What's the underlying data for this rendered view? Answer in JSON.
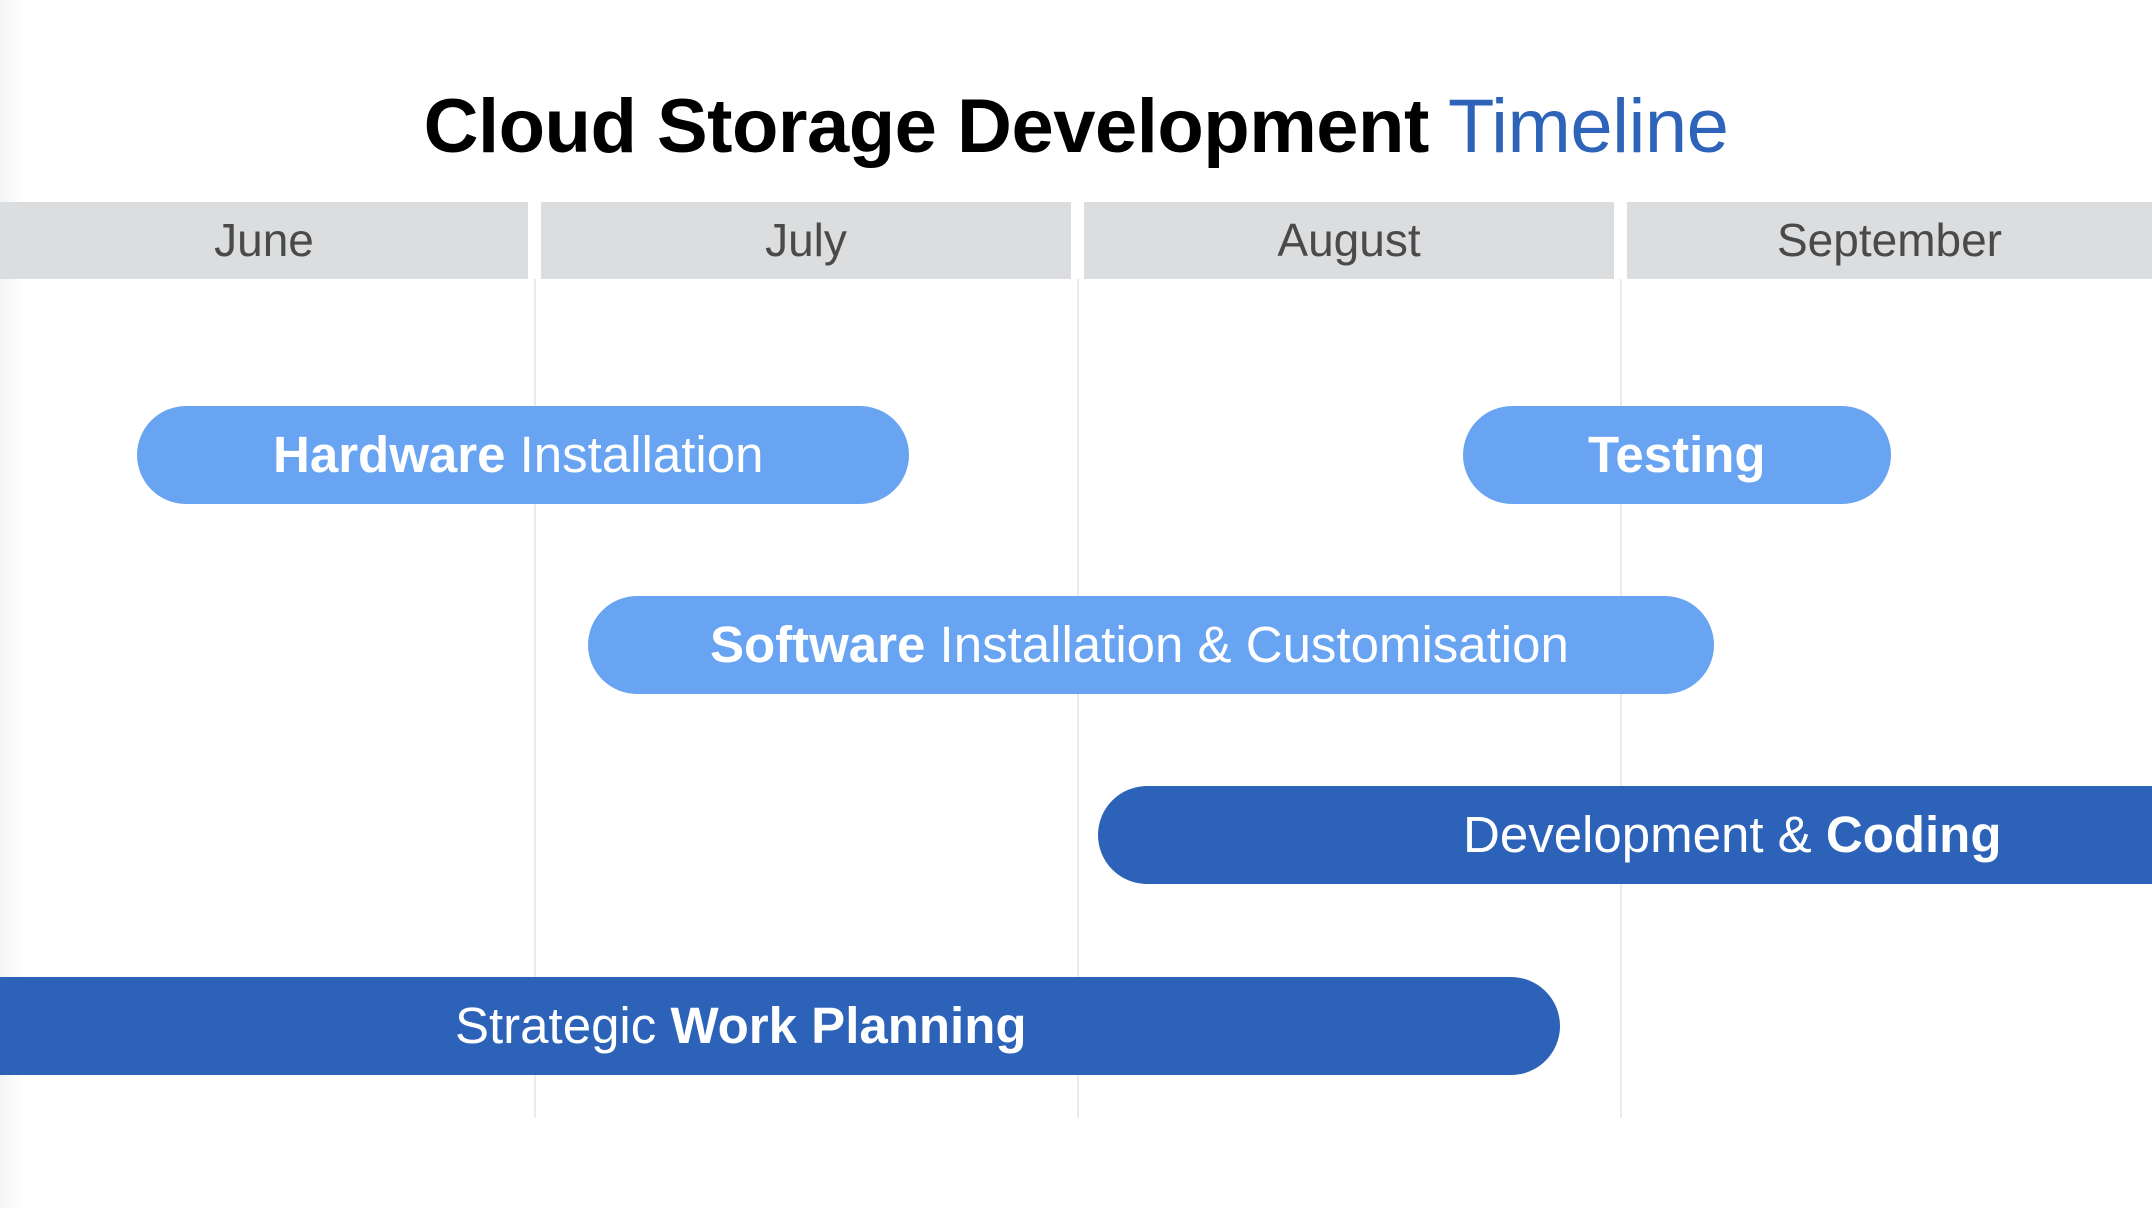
{
  "title": {
    "main": "Cloud Storage Development",
    "accent": "Timeline"
  },
  "months": [
    "June",
    "July",
    "August",
    "September"
  ],
  "tasks": [
    {
      "bold_first": "Hardware",
      "rest": " Installation"
    },
    {
      "bold": "Testing"
    },
    {
      "bold_first": "Software",
      "rest": " Installation & Customisation"
    },
    {
      "regular": "Development & ",
      "bold_last": "Coding"
    },
    {
      "regular": "Strategic ",
      "bold_last": "Work Planning"
    }
  ],
  "colors": {
    "title_accent": "#2d63b8",
    "bar_light": "#68a4f1",
    "bar_dark": "#2c62b8",
    "month_header_bg": "#dcdddf"
  }
}
